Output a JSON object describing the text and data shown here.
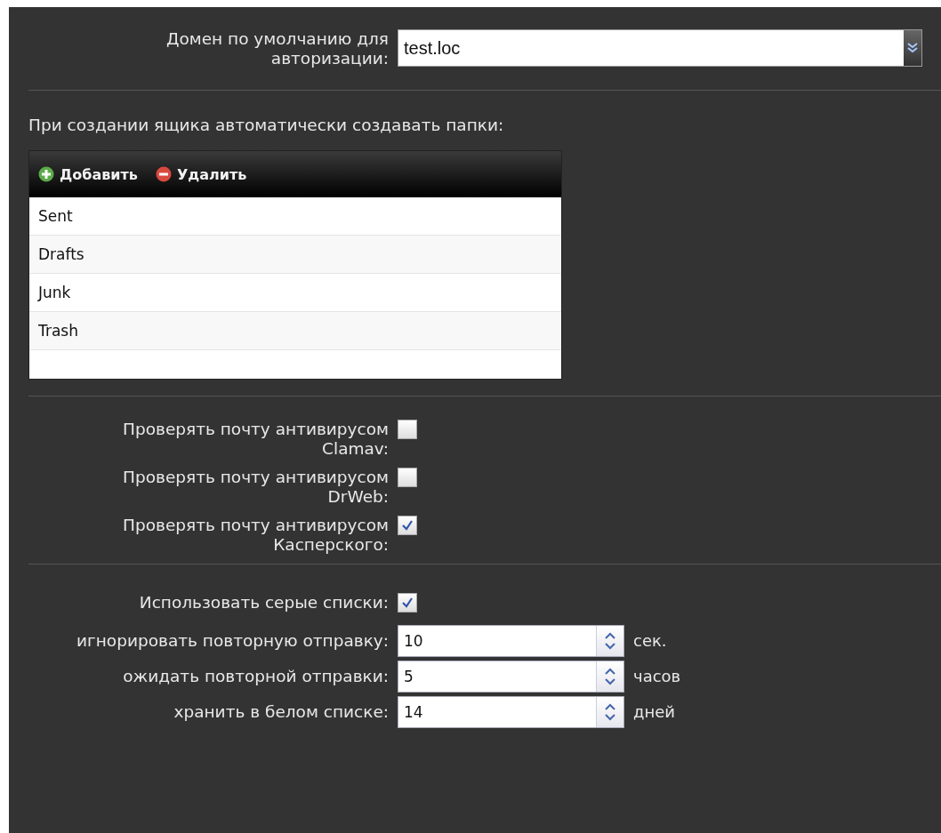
{
  "domain": {
    "label": "Домен по умолчанию для авторизации:",
    "value": "test.loc"
  },
  "folders": {
    "heading": "При создании ящика автоматически создавать папки:",
    "toolbar": [
      "Добавить",
      "Удалить"
    ],
    "rows": [
      "Sent",
      "Drafts",
      "Junk",
      "Trash"
    ]
  },
  "antivirus": [
    {
      "label": "Проверять почту антивирусом Clamav:",
      "checked": false
    },
    {
      "label": "Проверять почту антивирусом DrWeb:",
      "checked": false
    },
    {
      "label": "Проверять почту антивирусом Касперского:",
      "checked": true
    }
  ],
  "greylist": {
    "label": "Использовать серые списки:",
    "checked": true,
    "settings": [
      {
        "label": "игнорировать повторную отправку:",
        "value": "10",
        "unit": "сек."
      },
      {
        "label": "ожидать повторной отправки:",
        "value": "5",
        "unit": "часов"
      },
      {
        "label": "хранить в белом списке:",
        "value": "14",
        "unit": "дней"
      }
    ]
  }
}
